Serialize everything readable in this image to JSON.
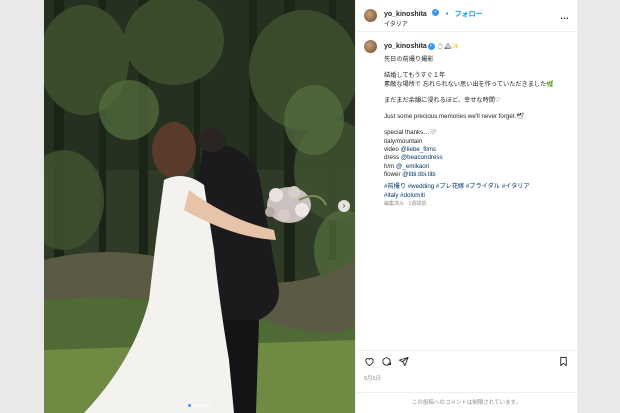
{
  "post": {
    "username": "yo_kinoshita",
    "follow_label": "フォロー",
    "separator": "•",
    "location": "イタリア",
    "more_label": "…",
    "caption_username": "yo_kinoshita",
    "caption_emoji": "💍🏔✨",
    "caption_lines": [
      "先日の前撮り撮影",
      "",
      "結婚してもうすぐ１年",
      "素敵な場所で 忘れられない思い出を作っていただきました🌿",
      "",
      "まだまだ余韻に浸れるほど、幸せな時間♡",
      "",
      "Just some precious memories we'll never forget.🕊",
      "",
      "special thanks…🤍",
      "italy/mountain"
    ],
    "credits": [
      {
        "label": "video ",
        "handle": "@liebe_films"
      },
      {
        "label": "dress ",
        "handle": "@beacondress"
      },
      {
        "label": "h/m ",
        "handle": "@_emikaori"
      },
      {
        "label": "flower ",
        "handle": "@tibi.tibi.tibi"
      }
    ],
    "hashtags_line1": "#前撮り #wedding #プレ花嫁 #ブライダル #イタリア",
    "hashtags_line2": "#italy #dolomiti",
    "edited_meta": "編集済み · 1週間前",
    "date": "8月5日",
    "comments_off": "この投稿へのコメントは制限されています。"
  },
  "carousel": {
    "next_label": "›",
    "slide_count": 5,
    "active_slide": 1
  },
  "colors": {
    "link": "#00376b",
    "follow": "#0095f6",
    "muted": "#8e8e8e"
  }
}
